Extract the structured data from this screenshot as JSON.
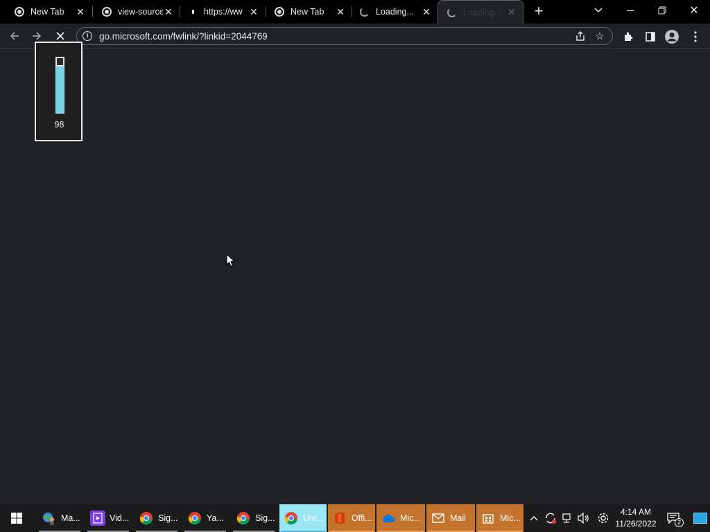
{
  "browser": {
    "tabs": [
      {
        "title": "New Tab",
        "favicon": "chrome-icon"
      },
      {
        "title": "view-source",
        "favicon": "chrome-icon"
      },
      {
        "title": "https://ww",
        "favicon": "dot-icon"
      },
      {
        "title": "New Tab",
        "favicon": "chrome-icon"
      },
      {
        "title": "Loading...",
        "favicon": "spinner-icon"
      },
      {
        "title": "Loading...",
        "favicon": "spinner-icon",
        "active": true
      }
    ],
    "new_tab_glyph": "+",
    "url": "go.microsoft.com/fwlink/?linkid=2044769"
  },
  "volume_popup": {
    "value": "98",
    "level_percent": 98
  },
  "taskbar": {
    "apps": [
      {
        "label": "Ma...",
        "icon": "globe-person-icon",
        "color": "#2e7d32"
      },
      {
        "label": "Vid...",
        "icon": "video-editor-icon",
        "color": "#7b3fe4"
      },
      {
        "label": "Sig...",
        "icon": "chrome-icon",
        "color": "#db4437"
      },
      {
        "label": "Ya...",
        "icon": "chrome-icon",
        "color": "#db4437"
      },
      {
        "label": "Sig...",
        "icon": "chrome-icon",
        "color": "#db4437"
      },
      {
        "label": "Unt...",
        "icon": "chrome-icon",
        "color": "#db4437",
        "active": true
      },
      {
        "label": "Offi...",
        "icon": "office-icon",
        "color": "#d83b01"
      },
      {
        "label": "Mic...",
        "icon": "onedrive-icon",
        "color": "#0f78d4"
      },
      {
        "label": "Mail",
        "icon": "mail-icon",
        "color": "#ffffff"
      },
      {
        "label": "Mic...",
        "icon": "store-icon",
        "color": "#ffffff"
      }
    ],
    "clock_time": "4:14 AM",
    "clock_date": "11/26/2022",
    "notification_count": "2"
  },
  "colors": {
    "taskbar_active_bg": "#99e6f5",
    "taskbar_orange_bg": "#c4742c",
    "volume_fill": "#77d3e6"
  }
}
